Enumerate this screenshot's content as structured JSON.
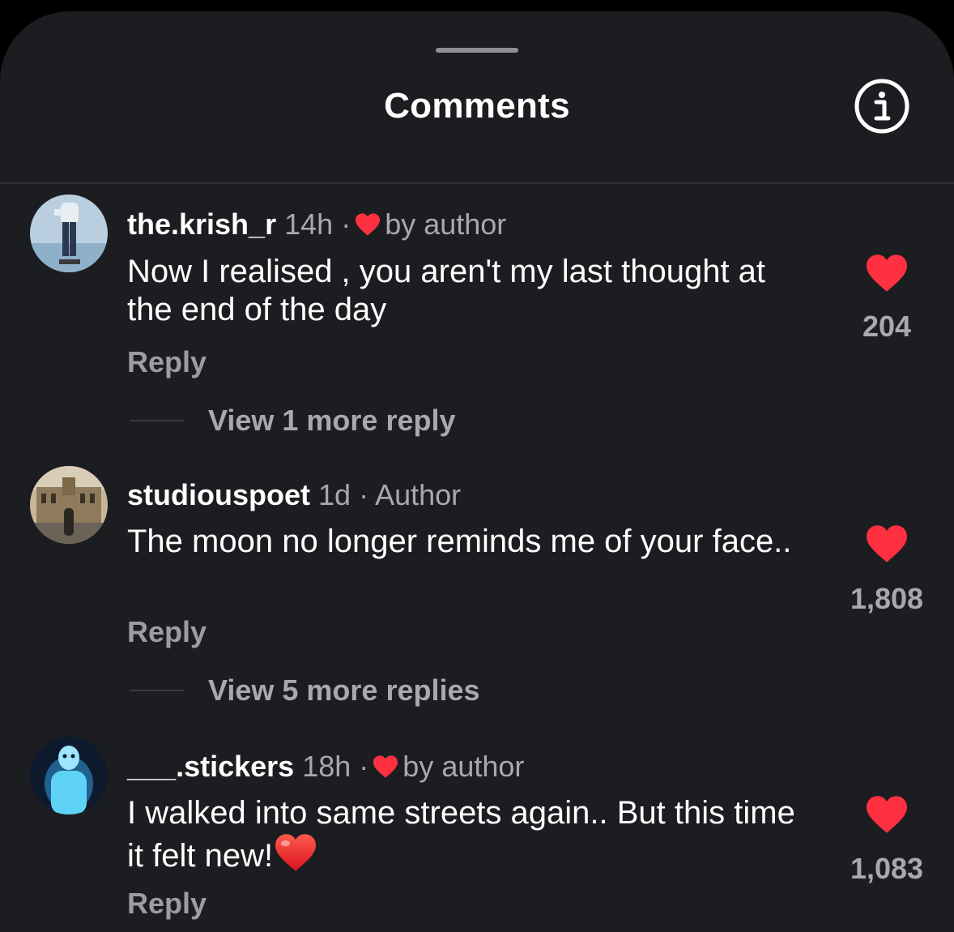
{
  "header": {
    "title": "Comments"
  },
  "icons": {
    "info": "info-icon",
    "like": "heart-icon",
    "liked_by_author": "heart-icon"
  },
  "colors": {
    "background": "#1c1d21",
    "like_red": "#ff3040",
    "text_primary": "#ffffff",
    "text_secondary": "#a8a8ad"
  },
  "comments": [
    {
      "username": "the.krish_r",
      "time": "14h",
      "separator": "·",
      "badge": "by author",
      "liked_by_author": true,
      "text": "Now I realised , you aren't my last thought at the end of the day",
      "reply_label": "Reply",
      "like_count": "204",
      "view_replies": "View 1 more reply"
    },
    {
      "username": "studiouspoet",
      "time": "1d",
      "separator": "·",
      "badge": "Author",
      "liked_by_author": false,
      "text": "The moon no longer reminds me of your face..",
      "reply_label": "Reply",
      "like_count": "1,808",
      "view_replies": "View 5 more replies"
    },
    {
      "username": "___.stickers",
      "time": "18h",
      "separator": "·",
      "badge": "by author",
      "liked_by_author": true,
      "text": "I walked into same streets again.. But this time it felt new!",
      "text_emoji": "❤️",
      "reply_label": "Reply",
      "like_count": "1,083"
    }
  ]
}
